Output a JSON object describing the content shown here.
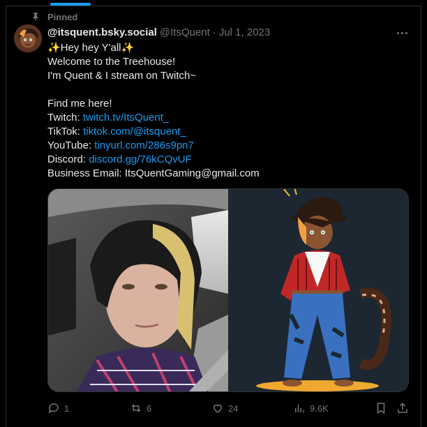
{
  "pinned_label": "Pinned",
  "author": {
    "display_name": "@itsquent.bsky.social",
    "handle": "@ItsQuent",
    "separator": "·",
    "date": "Jul 1, 2023"
  },
  "post": {
    "line1": "Hey hey Y'all",
    "line2": "Welcome to the Treehouse!",
    "line3": "I'm Quent & I stream on Twitch~",
    "find_me": "Find me here!",
    "links": [
      {
        "label": "Twitch: ",
        "url": "twitch.tv/ItsQuent_"
      },
      {
        "label": "TikTok: ",
        "url": "tiktok.com/@itsquent_"
      },
      {
        "label": "YouTube: ",
        "url": "tinyurl.com/286s9pn7"
      },
      {
        "label": "Discord: ",
        "url": "discord.gg/76kCQvUF"
      }
    ],
    "business": "Business Email: ItsQuentGaming@gmail.com"
  },
  "stats": {
    "replies": "1",
    "reposts": "6",
    "likes": "24",
    "views": "9.6K"
  },
  "colors": {
    "accent": "#1d9bf0",
    "muted": "#71767b",
    "text": "#e7e9ea",
    "border": "#2f3336"
  },
  "icons": [
    "pin-icon",
    "more-icon",
    "sparkle-icon",
    "reply-icon",
    "repost-icon",
    "like-icon",
    "views-icon",
    "bookmark-icon",
    "share-icon"
  ]
}
